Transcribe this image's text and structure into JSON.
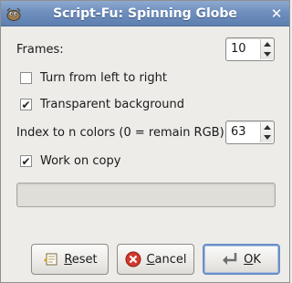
{
  "window": {
    "title": "Script-Fu: Spinning Globe",
    "close_glyph": "✕"
  },
  "form": {
    "frames_label": "Frames:",
    "frames_value": "10",
    "turn_label": "Turn from left to right",
    "turn_checked": false,
    "transparent_label": "Transparent background",
    "transparent_checked": true,
    "index_label": "Index to n colors (0 = remain RGB):",
    "index_value": "63",
    "work_on_copy_label": "Work on copy",
    "work_on_copy_checked": true,
    "progress": 0
  },
  "buttons": {
    "reset_mnemonic": "R",
    "reset_rest": "eset",
    "cancel_mnemonic": "C",
    "cancel_rest": "ancel",
    "ok_mnemonic": "O",
    "ok_rest": "K"
  },
  "icons": {
    "app": "gimp-icon",
    "reset": "reset-icon",
    "cancel": "cancel-icon",
    "ok": "ok-icon"
  },
  "colors": {
    "titlebar": "#6f8fbd",
    "cancel_red": "#d4382c",
    "window_bg": "#edece9"
  }
}
